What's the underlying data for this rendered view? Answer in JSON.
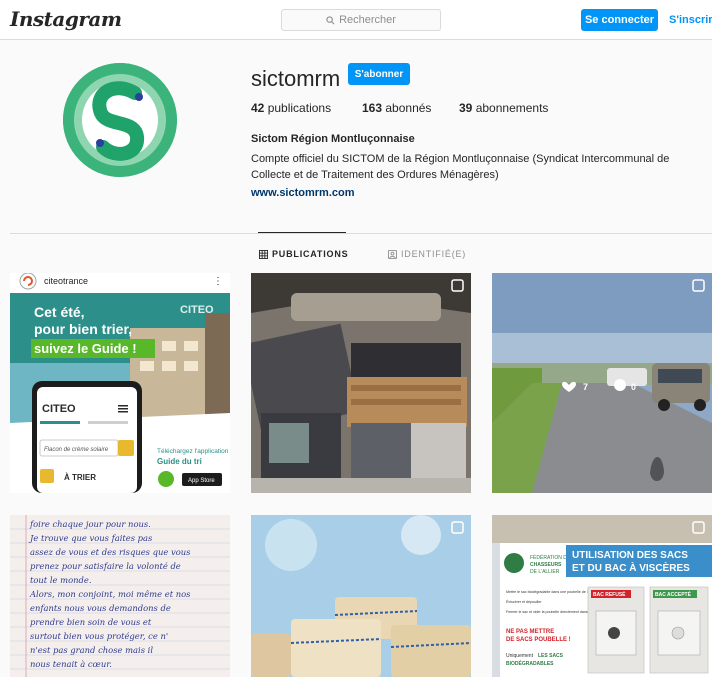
{
  "topbar": {
    "logo": "Instagram",
    "search_placeholder": "Rechercher",
    "login_label": "Se connecter",
    "signup_label": "S'inscrire"
  },
  "profile": {
    "username": "sictomrm",
    "follow_label": "S'abonner",
    "stats": [
      {
        "count": "42",
        "label": "publications"
      },
      {
        "count": "163",
        "label": "abonnés"
      },
      {
        "count": "39",
        "label": "abonnements"
      }
    ],
    "full_name": "Sictom Région Montluçonnaise",
    "bio": "Compte officiel du SICTOM de la Région Montluçonnaise (Syndicat Intercommunal de Collecte et de Traitement des Ordures Ménagères)",
    "website": "www.sictomrm.com"
  },
  "tabs": {
    "publications": "PUBLICATIONS",
    "tagged": "IDENTIFIÉ(E)"
  },
  "posts": {
    "post1": {
      "account": "citeotrance",
      "headline_1": "Cet été,",
      "headline_2": "pour bien trier,",
      "headline_3": "suivez le Guide !",
      "brand": "CITEO",
      "phone_brand": "CITEO",
      "phone_search": "Flacon de crème solaire",
      "phone_sort": "À TRIER",
      "download_1": "Téléchargez l'application",
      "download_2": "Guide du tri",
      "store": "App Store"
    },
    "post3": {
      "likes": "7",
      "comments": "0"
    },
    "post4": {
      "line_1": "foire chaque jour pour nous.",
      "line_2": "Je trouve que vous faites pas",
      "line_3": "assez de vous et des risques que vous",
      "line_4": "prenez pour satisfaire la volonté de",
      "line_5": "tout le monde.",
      "line_6": "Alors, mon conjoint, moi même et nos",
      "line_7": "enfants nous vous demandons de",
      "line_8": "prendre bien soin de vous et",
      "line_9": "surtout bien vous protéger, ce n'",
      "line_10": "n'est pas grand chose mais il",
      "line_11": "nous tenait à cœur."
    },
    "post6": {
      "org_1": "FÉDÉRATION DES",
      "org_2": "CHASSEURS",
      "org_3": "DE L'ALLIER",
      "title_1": "UTILISATION DES SACS",
      "title_2": "ET DU BAC À VISCÈRES",
      "bullet_1": "Mettre le sac biodégradable dans une poubelle de 100 litres",
      "bullet_2": "Éviscérer et dépouiller",
      "bullet_3": "Fermer le sac et vider la poubelle directement dans le bac",
      "warning_1": "NE PAS METTRE",
      "warning_2": "DE SACS POUBELLE !",
      "footer_1": "Uniquement",
      "footer_2": "LES SACS",
      "footer_3": "BIODÉGRADABLES",
      "refused": "BAC REFUSÉ",
      "accepted": "BAC ACCEPTÉ"
    }
  }
}
